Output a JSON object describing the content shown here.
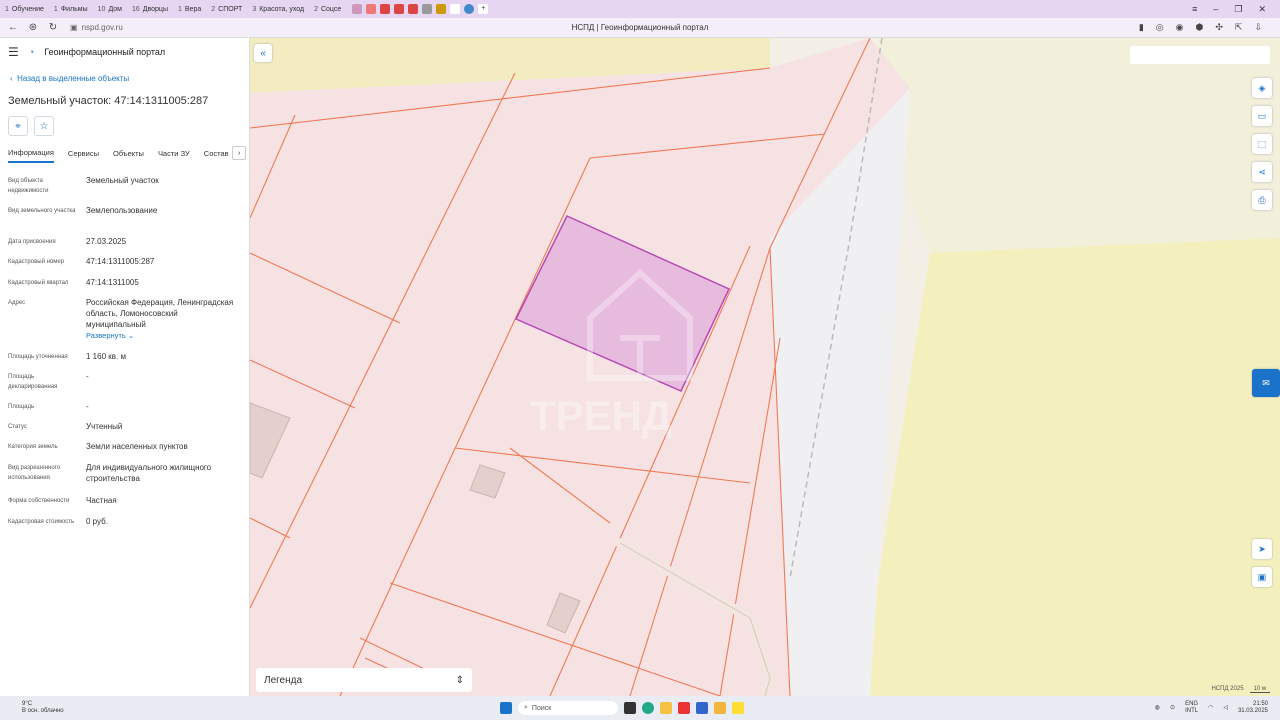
{
  "browser": {
    "tabs": [
      {
        "num": "1",
        "label": "Обучение"
      },
      {
        "num": "1",
        "label": "Фильмы"
      },
      {
        "num": "10",
        "label": "Дом"
      },
      {
        "num": "16",
        "label": "Дворцы"
      },
      {
        "num": "1",
        "label": "Вера"
      },
      {
        "num": "2",
        "label": "СПОРТ"
      },
      {
        "num": "3",
        "label": "Красота, уход"
      },
      {
        "num": "2",
        "label": "Соцсе"
      }
    ],
    "url": "nspd.gov.ru",
    "page_title": "НСПД | Геоинформационный портал"
  },
  "sidebar": {
    "portal_name": "Геоинформационный портал",
    "back_link": "Назад в выделенные объекты",
    "object_title": "Земельный участок: 47:14:1311005:287",
    "tabs": [
      "Информация",
      "Сервисы",
      "Объекты",
      "Части ЗУ",
      "Состав"
    ],
    "tab_more": "›",
    "properties": [
      {
        "label": "Вид объекта недвижимости",
        "value": "Земельный участок"
      },
      {
        "label": "Вид земельного участка",
        "value": "Землепользование"
      },
      {
        "label": "Дата присвоения",
        "value": "27.03.2025"
      },
      {
        "label": "Кадастровый номер",
        "value": "47:14:1311005:287"
      },
      {
        "label": "Кадастровый квартал",
        "value": "47:14:1311005"
      },
      {
        "label": "Адрес",
        "value": "Российская Федерация, Ленинградская область, Ломоносовский муниципальный"
      },
      {
        "label": "Площадь уточненная",
        "value": "1 160 кв. м"
      },
      {
        "label": "Площадь декларированная",
        "value": "-"
      },
      {
        "label": "Площадь",
        "value": "-"
      },
      {
        "label": "Статус",
        "value": "Учтенный"
      },
      {
        "label": "Категория земель",
        "value": "Земли населенных пунктов"
      },
      {
        "label": "Вид разрешенного использования",
        "value": "Для индивидуального жилищного строительства"
      },
      {
        "label": "Форма собственности",
        "value": "Частная"
      },
      {
        "label": "Кадастровая стоимость",
        "value": "0 руб."
      }
    ],
    "expand_label": "Развернуть"
  },
  "map": {
    "legend_label": "Легенда",
    "attribution": "НСПД 2025",
    "scale_label": "10 м",
    "watermark": "ТРЕНД"
  },
  "taskbar": {
    "temp": "9°C",
    "weather": "В осн. облачно",
    "search": "Поиск",
    "lang": "ENG",
    "lang2": "INTL",
    "time": "21:50",
    "date": "31.03.2025"
  }
}
